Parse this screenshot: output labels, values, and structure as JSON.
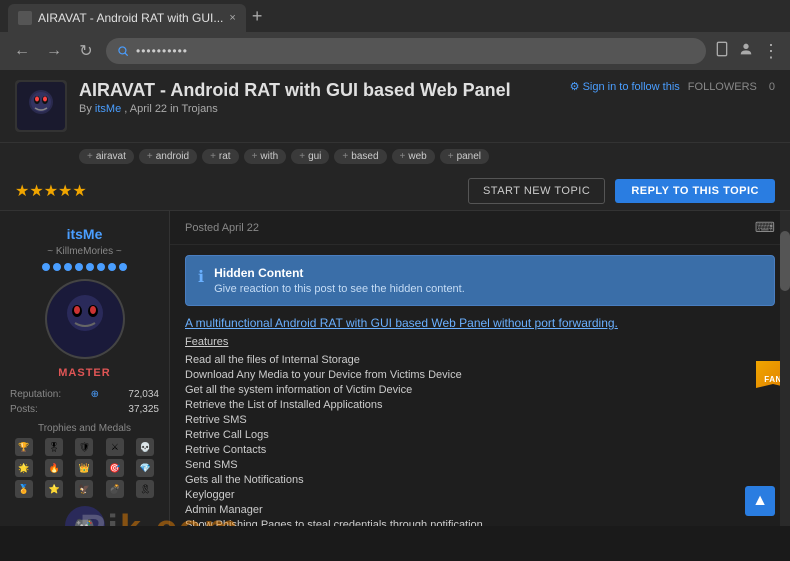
{
  "browser": {
    "tab_title": "AIRAVAT - Android RAT with GUI...",
    "tab_close": "×",
    "tab_new": "+",
    "nav_back": "←",
    "nav_forward": "→",
    "nav_refresh": "↻",
    "address_dots": "••••••••••",
    "menu_icon": "⋮"
  },
  "forum": {
    "title": "AIRAVAT - Android RAT with GUI based Web Panel",
    "sign_in_follow": "⚙ Sign in to follow this",
    "followers_label": "FOLLOWERS",
    "followers_count": "0",
    "subtitle": "By",
    "author": "itsMe",
    "date": ", April 22 in",
    "category": "Trojans",
    "tags": [
      "airavat",
      "android",
      "rat",
      "with",
      "gui",
      "based",
      "web",
      "panel"
    ],
    "stars": "★★★★★",
    "btn_start_new": "START NEW TOPIC",
    "btn_reply": "REPLY TO THIS TOPIC"
  },
  "post": {
    "meta_date": "Posted April 22",
    "fan_ribbon": "FAN",
    "hidden_title": "Hidden Content",
    "hidden_desc": "Give reaction to this post to see the hidden content.",
    "main_link": "A multifunctional Android RAT with GUI based Web Panel without port forwarding.",
    "section_title": "Features",
    "features": [
      "Read all the files of Internal Storage",
      "Download Any Media to your Device from Victims Device",
      "Get all the system information of Victim Device",
      "Retrieve the List of Installed Applications",
      "Retrive SMS",
      "Retrive Call Logs",
      "Retrive Contacts",
      "Send SMS",
      "Gets all the Notifications",
      "Keylogger",
      "Admin Manager",
      "Show Phishing Pages to steal credentials through notification."
    ]
  },
  "user": {
    "name": "itsMe",
    "alias": "~ KillmeMories ~",
    "rank": "MASTER",
    "reputation_label": "Reputation:",
    "reputation_icon": "⊕",
    "reputation_value": "72,034",
    "posts_label": "Posts:",
    "posts_value": "37,325",
    "trophies_label": "Trophies and Medals",
    "trophies": [
      "🏆",
      "🎖",
      "🛡",
      "⚔",
      "💀",
      "🌟",
      "🔥",
      "👑",
      "🎯",
      "💎",
      "🏅",
      "⭐",
      "🦅",
      "💣",
      "🎗"
    ],
    "avatar_bottom": "🎮"
  },
  "watermark": {
    "text": "Pi",
    "suffix": "k.com"
  },
  "scroll_top": "▲"
}
